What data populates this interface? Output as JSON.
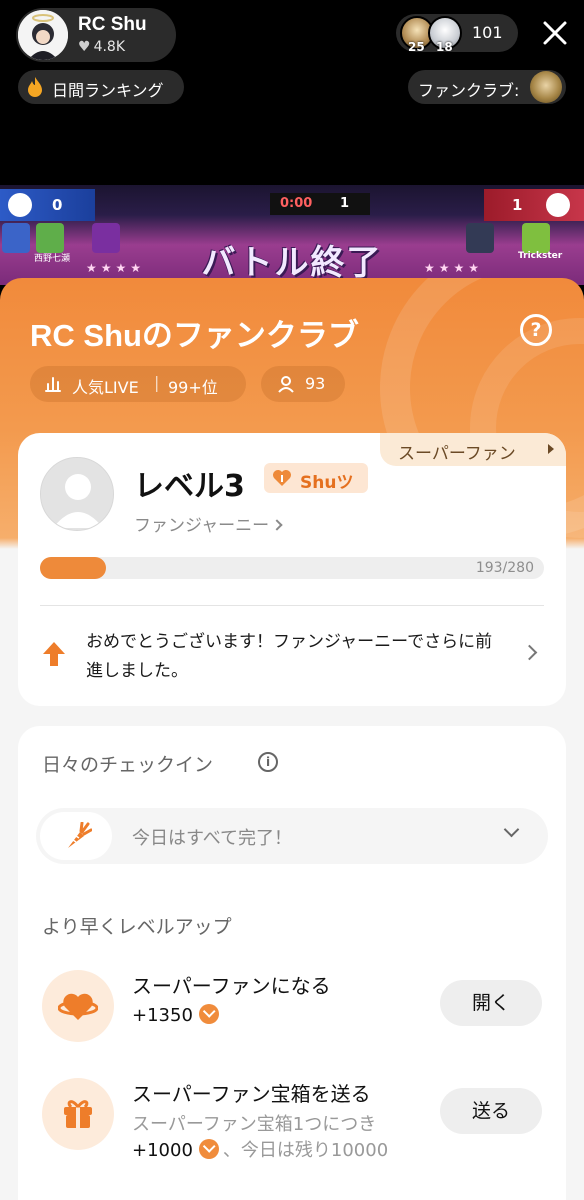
{
  "stream": {
    "host_name": "RC Shu",
    "host_likes": "4.8K",
    "viewer_badges": [
      "25",
      "18"
    ],
    "viewer_count": "101",
    "daily_ranking_label": "日間ランキング",
    "fanclub_label": "ファンクラブ:"
  },
  "game": {
    "score_left": "0",
    "score_right": "1",
    "timer": "0:00",
    "timer_count": "1",
    "battle_status": "バトル終了",
    "player_left": "西野七瀬",
    "player_right": "Trickster"
  },
  "fanclub": {
    "title": "RC Shuのファンクラブ",
    "help_icon": "question-circle-icon",
    "popularity_label": "人気LIVE",
    "popularity_rank": "99+位",
    "member_count": "93"
  },
  "level_card": {
    "superfan_tag": "スーパーファン",
    "level_label": "レベル3",
    "fan_badge_name": "Shuツ",
    "journey_link": "ファンジャーニー",
    "progress_text": "193/280",
    "progress_current": 193,
    "progress_max": 280,
    "congrats_message": "おめでとうございます！ファンジャーニーでさらに前進しました。"
  },
  "checkin": {
    "title": "日々のチェックイン",
    "status_text": "今日はすべて完了！"
  },
  "level_up": {
    "title": "より早くレベルアップ",
    "tasks": [
      {
        "title": "スーパーファンになる",
        "points": "+1350",
        "button": "開く",
        "icon": "planet-heart-icon"
      },
      {
        "title": "スーパーファン宝箱を送る",
        "subtitle": "スーパーファン宝箱1つにつき",
        "points": "+1000",
        "suffix": "、今日は残り10000",
        "button": "送る",
        "icon": "gift-icon"
      }
    ]
  },
  "colors": {
    "accent": "#F18A3B",
    "badge_bg": "#FDE6D3",
    "superfan_tag_bg": "#FBEAD6"
  }
}
